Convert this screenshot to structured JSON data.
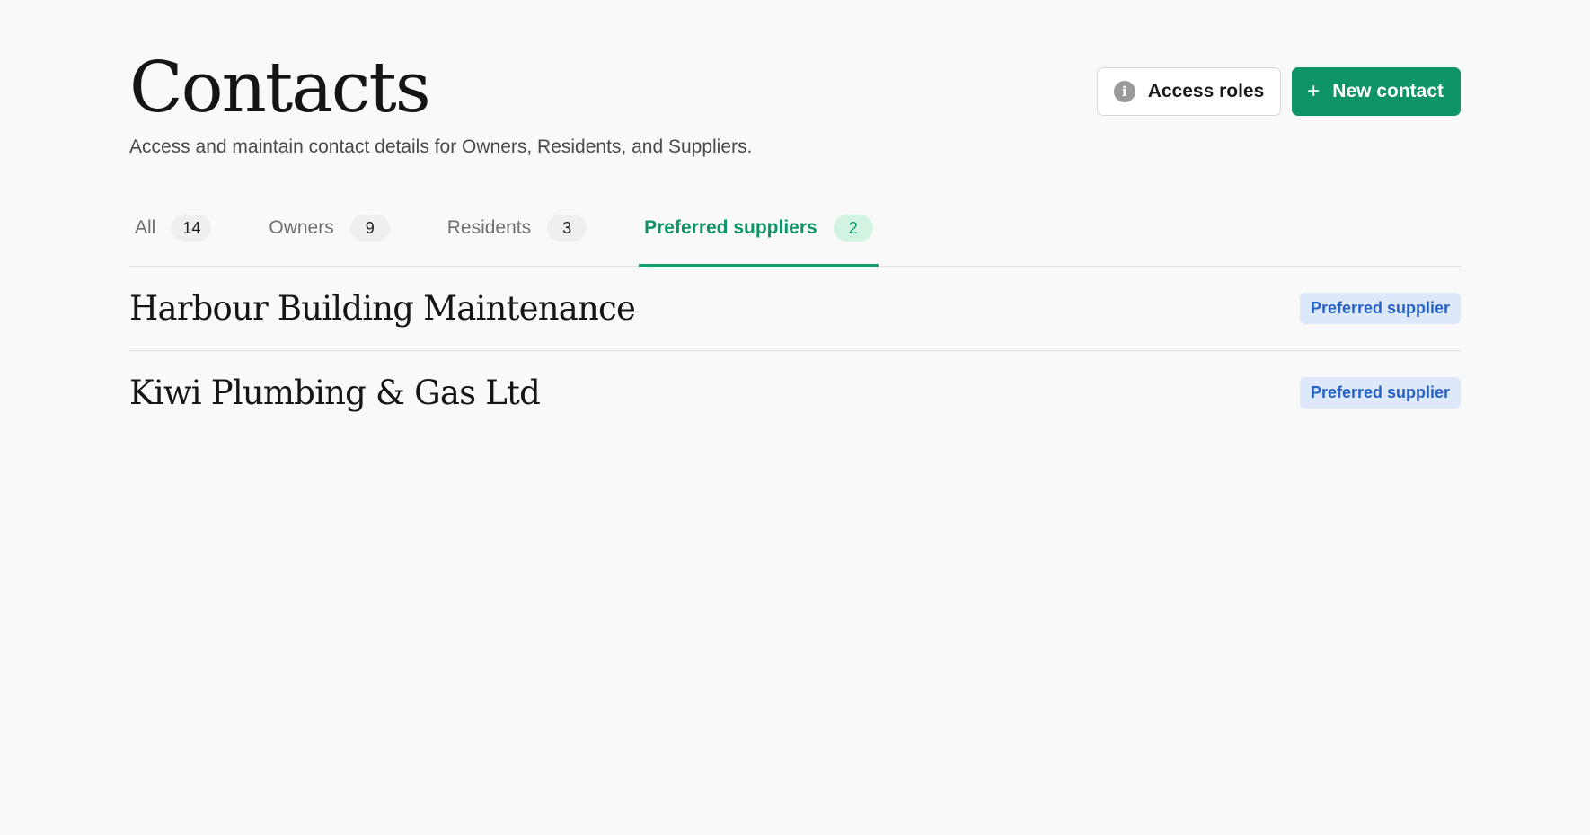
{
  "header": {
    "title": "Contacts",
    "subtitle": "Access and maintain contact details for Owners, Residents, and Suppliers.",
    "access_roles_label": "Access roles",
    "new_contact_label": "New contact"
  },
  "icons": {
    "info": "info-icon",
    "plus": "plus-icon"
  },
  "colors": {
    "accent": "#0e9466",
    "badge_text": "#2762c4",
    "badge_bg": "#dde9fa"
  },
  "tabs": [
    {
      "label": "All",
      "count": "14",
      "active": false
    },
    {
      "label": "Owners",
      "count": "9",
      "active": false
    },
    {
      "label": "Residents",
      "count": "3",
      "active": false
    },
    {
      "label": "Preferred suppliers",
      "count": "2",
      "active": true
    }
  ],
  "contacts": [
    {
      "name": "Harbour Building Maintenance",
      "badge": "Preferred supplier"
    },
    {
      "name": "Kiwi Plumbing & Gas Ltd",
      "badge": "Preferred supplier"
    }
  ]
}
